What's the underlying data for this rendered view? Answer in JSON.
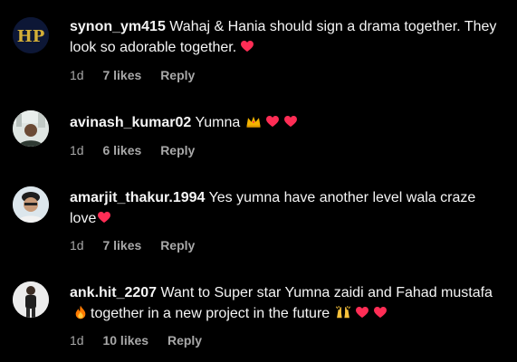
{
  "comments": [
    {
      "username": "synon_ym415",
      "text": "Wahaj & Hania should sign a drama together. They look so adorable together.",
      "emojis": [
        "red-heart"
      ],
      "time": "1d",
      "likes": "7 likes",
      "reply": "Reply",
      "avatar_initials": "HP"
    },
    {
      "username": "avinash_kumar02",
      "text": "Yumna",
      "emojis": [
        "crown",
        "red-heart",
        "red-heart"
      ],
      "time": "1d",
      "likes": "6 likes",
      "reply": "Reply"
    },
    {
      "username": "amarjit_thakur.1994",
      "text": "Yes yumna have another level wala craze love",
      "emojis": [
        "red-heart"
      ],
      "time": "1d",
      "likes": "7 likes",
      "reply": "Reply"
    },
    {
      "username": "ank.hit_2207",
      "text": "Want to Super star Yumna zaidi and Fahad mustafa",
      "text2": "together in a new project in the future",
      "emojis": [
        "fire"
      ],
      "emojis2": [
        "raising-hands",
        "red-heart",
        "red-heart"
      ],
      "time": "1d",
      "likes": "10 likes",
      "reply": "Reply"
    }
  ],
  "colors": {
    "background": "#000000",
    "text": "#f5f5f5",
    "meta": "#a8a8a8",
    "heart": "#ff2d55"
  }
}
